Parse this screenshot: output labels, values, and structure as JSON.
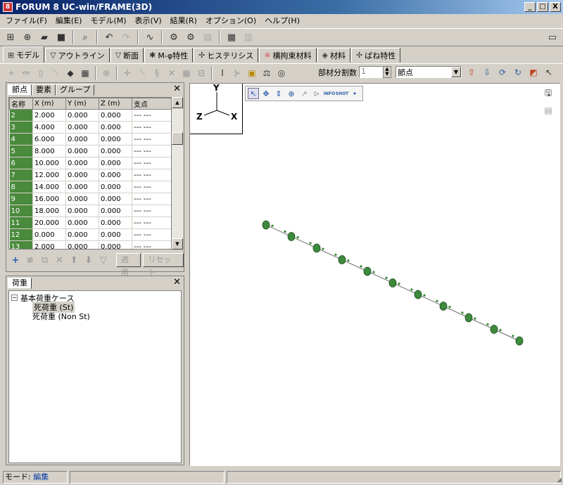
{
  "window": {
    "title": "FORUM 8   UC-win/FRAME(3D)",
    "minimize": "_",
    "maximize": "□",
    "close": "X"
  },
  "menu": [
    "ファイル(F)",
    "編集(E)",
    "モデル(M)",
    "表示(V)",
    "結果(R)",
    "オプション(O)",
    "ヘルプ(H)"
  ],
  "tabs": [
    {
      "label": "モデル",
      "icon": "model-icon",
      "glyph": "⊞"
    },
    {
      "label": "アウトライン",
      "icon": "outline-icon",
      "glyph": "▽"
    },
    {
      "label": "断面",
      "icon": "section-icon",
      "glyph": "▽"
    },
    {
      "label": "M-φ特性",
      "icon": "m-phi-icon",
      "glyph": "✱"
    },
    {
      "label": "ヒステリシス",
      "icon": "hysteresis-icon",
      "glyph": "✢"
    },
    {
      "label": "横拘束材料",
      "icon": "confinement-icon",
      "glyph": "※"
    },
    {
      "label": "材料",
      "icon": "material-icon",
      "glyph": "◈"
    },
    {
      "label": "ばね特性",
      "icon": "spring-icon",
      "glyph": "✢"
    }
  ],
  "toolbar2": {
    "division_label": "部材分割数",
    "division_value": "1",
    "select_value": "節点"
  },
  "node_panel": {
    "tabs": [
      "節点",
      "要素",
      "グループ"
    ],
    "columns": [
      "名称",
      "X (m)",
      "Y (m)",
      "Z (m)",
      "支点"
    ],
    "rows": [
      [
        "2",
        "2.000",
        "0.000",
        "0.000",
        "--- ---"
      ],
      [
        "3",
        "4.000",
        "0.000",
        "0.000",
        "--- ---"
      ],
      [
        "4",
        "6.000",
        "0.000",
        "0.000",
        "--- ---"
      ],
      [
        "5",
        "8.000",
        "0.000",
        "0.000",
        "--- ---"
      ],
      [
        "6",
        "10.000",
        "0.000",
        "0.000",
        "--- ---"
      ],
      [
        "7",
        "12.000",
        "0.000",
        "0.000",
        "--- ---"
      ],
      [
        "8",
        "14.000",
        "0.000",
        "0.000",
        "--- ---"
      ],
      [
        "9",
        "16.000",
        "0.000",
        "0.000",
        "--- ---"
      ],
      [
        "10",
        "18.000",
        "0.000",
        "0.000",
        "--- ---"
      ],
      [
        "11",
        "20.000",
        "0.000",
        "0.000",
        "--- ---"
      ],
      [
        "12",
        "0.000",
        "0.000",
        "0.000",
        "--- ---"
      ],
      [
        "13",
        "2.000",
        "0.000",
        "0.000",
        "--- ---"
      ]
    ],
    "apply_label": "適用",
    "reset_label": "リセット"
  },
  "load_panel": {
    "tab": "荷重",
    "root": "基本荷重ケース",
    "children": [
      "死荷重 (St)",
      "死荷重 (Non St)"
    ]
  },
  "axes": {
    "x": "X",
    "y": "Y",
    "z": "Z"
  },
  "view_tools": {
    "info": "INFO",
    "shot": "SHOT"
  },
  "status": {
    "mode_label": "モード: ",
    "mode_value": "編集"
  },
  "colors": {
    "node": "#3c8a3c",
    "row_header": "#4a8a3c",
    "title_start": "#0a246a"
  }
}
